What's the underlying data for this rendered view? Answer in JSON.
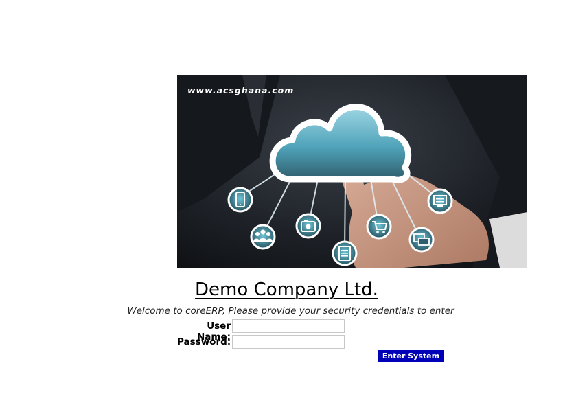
{
  "banner": {
    "site_url": "www.acsghana.com",
    "icons": [
      "tablet-icon",
      "camera-icon",
      "users-icon",
      "document-icon",
      "cart-icon",
      "computers-icon",
      "monitor-icon"
    ]
  },
  "login": {
    "company_name": "Demo Company Ltd.",
    "welcome_text": "Welcome to coreERP, Please provide your security credentials to enter",
    "username_label": "User Name:",
    "username_value": "",
    "password_label": "Password:",
    "password_value": "",
    "submit_label": "Enter System"
  },
  "colors": {
    "button_bg": "#0000b8",
    "button_text": "#ffffff",
    "cloud_accent": "#5eb6cc"
  }
}
